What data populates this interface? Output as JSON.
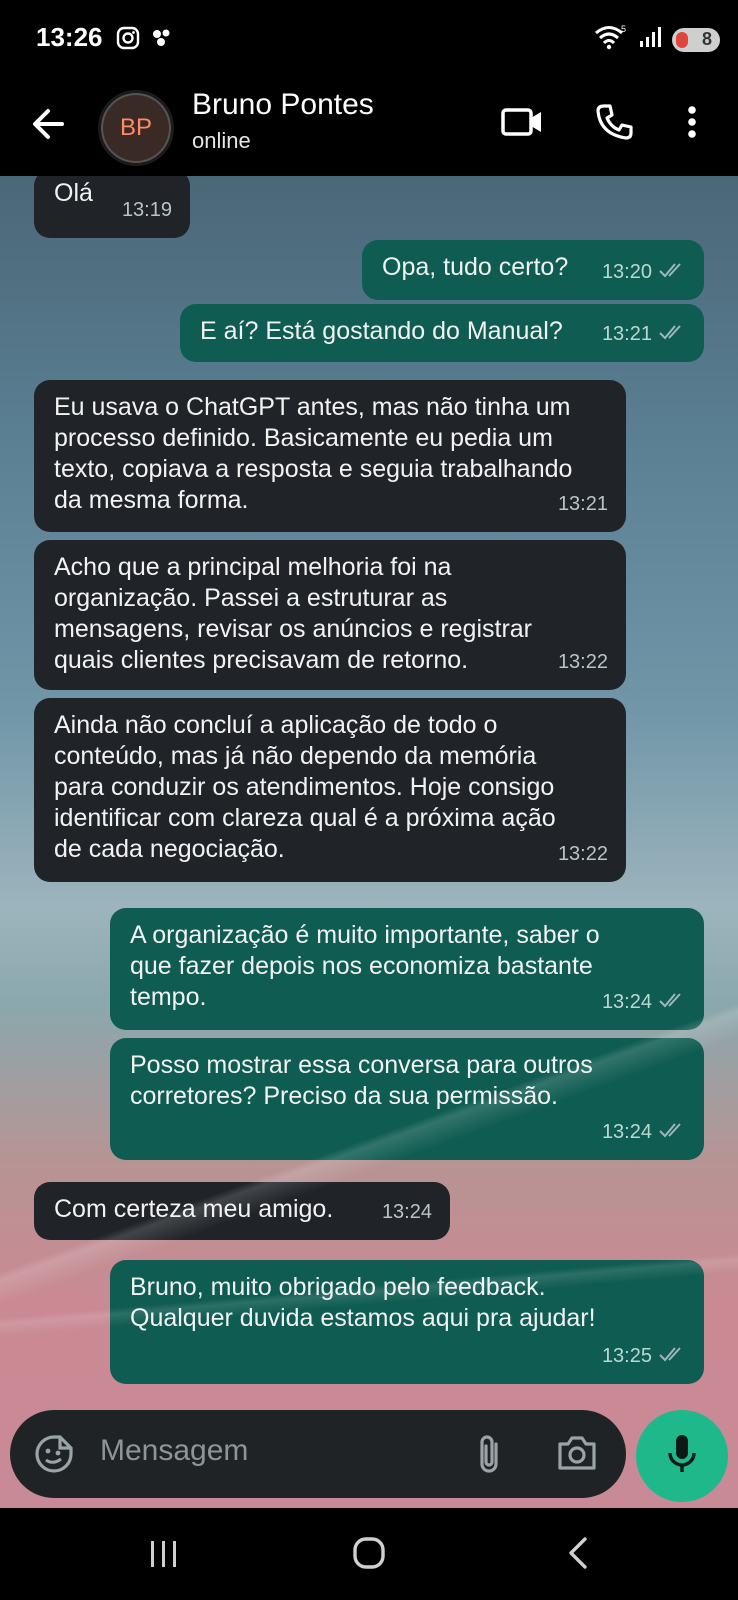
{
  "status_bar": {
    "time": "13:26",
    "battery_level": "8"
  },
  "header": {
    "avatar_initials": "BP",
    "contact_name": "Bruno Pontes",
    "contact_status": "online"
  },
  "messages": [
    {
      "direction": "in",
      "text": "Olá",
      "time": "13:19"
    },
    {
      "direction": "out",
      "text": "Opa, tudo certo?",
      "time": "13:20"
    },
    {
      "direction": "out",
      "text": "E aí? Está gostando do Manual?",
      "time": "13:21"
    },
    {
      "direction": "in",
      "text": "Eu usava o ChatGPT antes, mas não tinha um\nprocesso definido. Basicamente eu pedia um\ntexto, copiava a resposta e seguia trabalhando\nda mesma forma.",
      "time": "13:21"
    },
    {
      "direction": "in",
      "text": "Acho que a principal melhoria foi na\norganização. Passei a estruturar as\nmensagens, revisar os anúncios e registrar\nquais clientes precisavam de retorno.",
      "time": "13:22"
    },
    {
      "direction": "in",
      "text": "Ainda não concluí a aplicação de todo o\nconteúdo, mas já não dependo da memória\npara conduzir os atendimentos. Hoje consigo\nidentificar com clareza qual é a próxima ação\nde cada negociação.",
      "time": "13:22"
    },
    {
      "direction": "out",
      "text": "A organização é muito importante, saber o\nque fazer depois nos economiza bastante\ntempo.",
      "time": "13:24"
    },
    {
      "direction": "out",
      "text": "Posso mostrar essa conversa para outros\ncorretores? Preciso da sua permissão.",
      "time": "13:24"
    },
    {
      "direction": "in",
      "text": "Com certeza meu amigo.",
      "time": "13:24"
    },
    {
      "direction": "out",
      "text": "Bruno, muito obrigado pelo feedback.\nQualquer duvida estamos aqui pra ajudar!",
      "time": "13:25"
    }
  ],
  "input": {
    "placeholder": "Mensagem"
  },
  "colors": {
    "incoming_bubble": "#202428",
    "outgoing_bubble": "#0f5c52",
    "mic_button": "#1fb88a"
  }
}
